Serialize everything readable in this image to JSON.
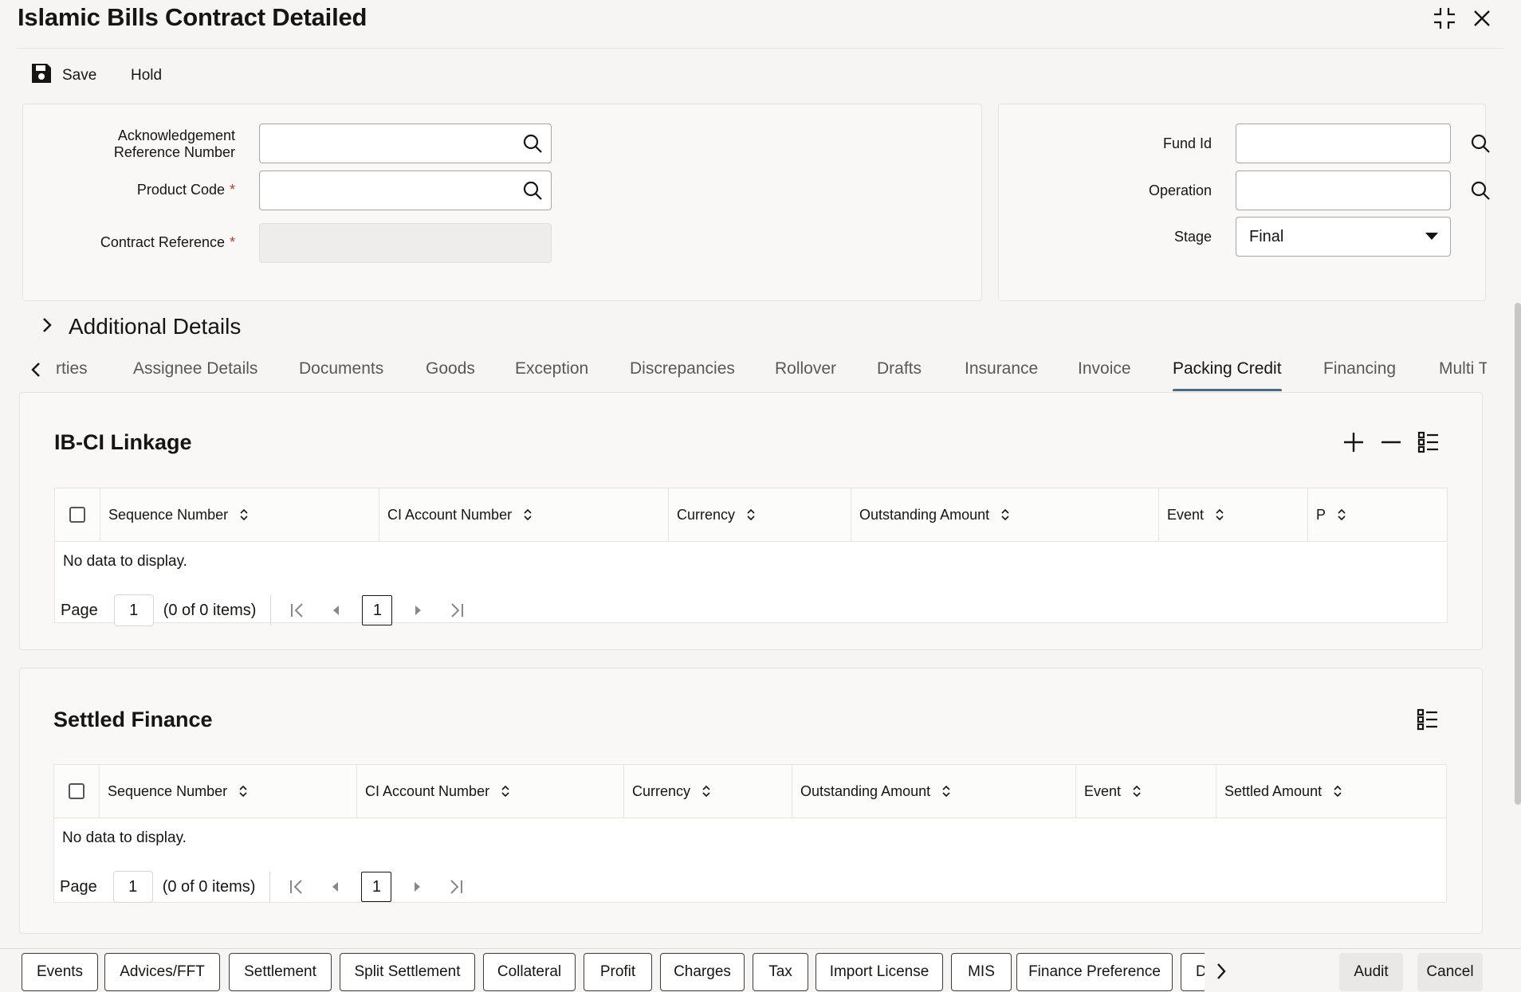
{
  "window": {
    "title": "Islamic Bills Contract Detailed"
  },
  "toolbar": {
    "save_label": "Save",
    "hold_label": "Hold"
  },
  "form": {
    "ack_ref_label_1": "Acknowledgement",
    "ack_ref_label_2": "Reference Number",
    "ack_ref_value": "",
    "product_code_label": "Product Code",
    "product_code_value": "",
    "contract_ref_label": "Contract Reference",
    "contract_ref_value": "",
    "required_mark": "*",
    "fund_id_label": "Fund Id",
    "fund_id_value": "",
    "operation_label": "Operation",
    "operation_value": "",
    "stage_label": "Stage",
    "stage_value": "Final"
  },
  "additional_details": {
    "label": "Additional Details"
  },
  "tabs": [
    "rties",
    "Assignee Details",
    "Documents",
    "Goods",
    "Exception",
    "Discrepancies",
    "Rollover",
    "Drafts",
    "Insurance",
    "Invoice",
    "Packing Credit",
    "Financing",
    "Multi T"
  ],
  "active_tab": "Packing Credit",
  "ibci": {
    "title": "IB-CI Linkage",
    "columns": [
      "Sequence Number",
      "CI Account Number",
      "Currency",
      "Outstanding Amount",
      "Event",
      "P"
    ],
    "no_data": "No data to display.",
    "page_label": "Page",
    "page_value": "1",
    "items_text": "(0 of 0 items)",
    "current_page": "1"
  },
  "settled": {
    "title": "Settled Finance",
    "columns": [
      "Sequence Number",
      "CI Account Number",
      "Currency",
      "Outstanding Amount",
      "Event",
      "Settled Amount"
    ],
    "no_data": "No data to display.",
    "page_label": "Page",
    "page_value": "1",
    "items_text": "(0 of 0 items)",
    "current_page": "1"
  },
  "footer": {
    "buttons": [
      "Events",
      "Advices/FFT",
      "Settlement",
      "Split Settlement",
      "Collateral",
      "Profit",
      "Charges",
      "Tax",
      "Import License",
      "MIS",
      "Finance Preference",
      "D"
    ],
    "audit_label": "Audit",
    "cancel_label": "Cancel"
  },
  "colors": {
    "accent": "#4b6a87",
    "required": "#c23a28",
    "text": "#161513"
  },
  "icons": [
    "restore-icon",
    "close-icon",
    "save-icon",
    "search-icon",
    "chevron-right-icon",
    "chevron-left-icon",
    "plus-icon",
    "minus-icon",
    "column-list-icon",
    "sort-icon",
    "first-page-icon",
    "prev-page-icon",
    "next-page-icon",
    "last-page-icon",
    "caret-down-icon"
  ]
}
